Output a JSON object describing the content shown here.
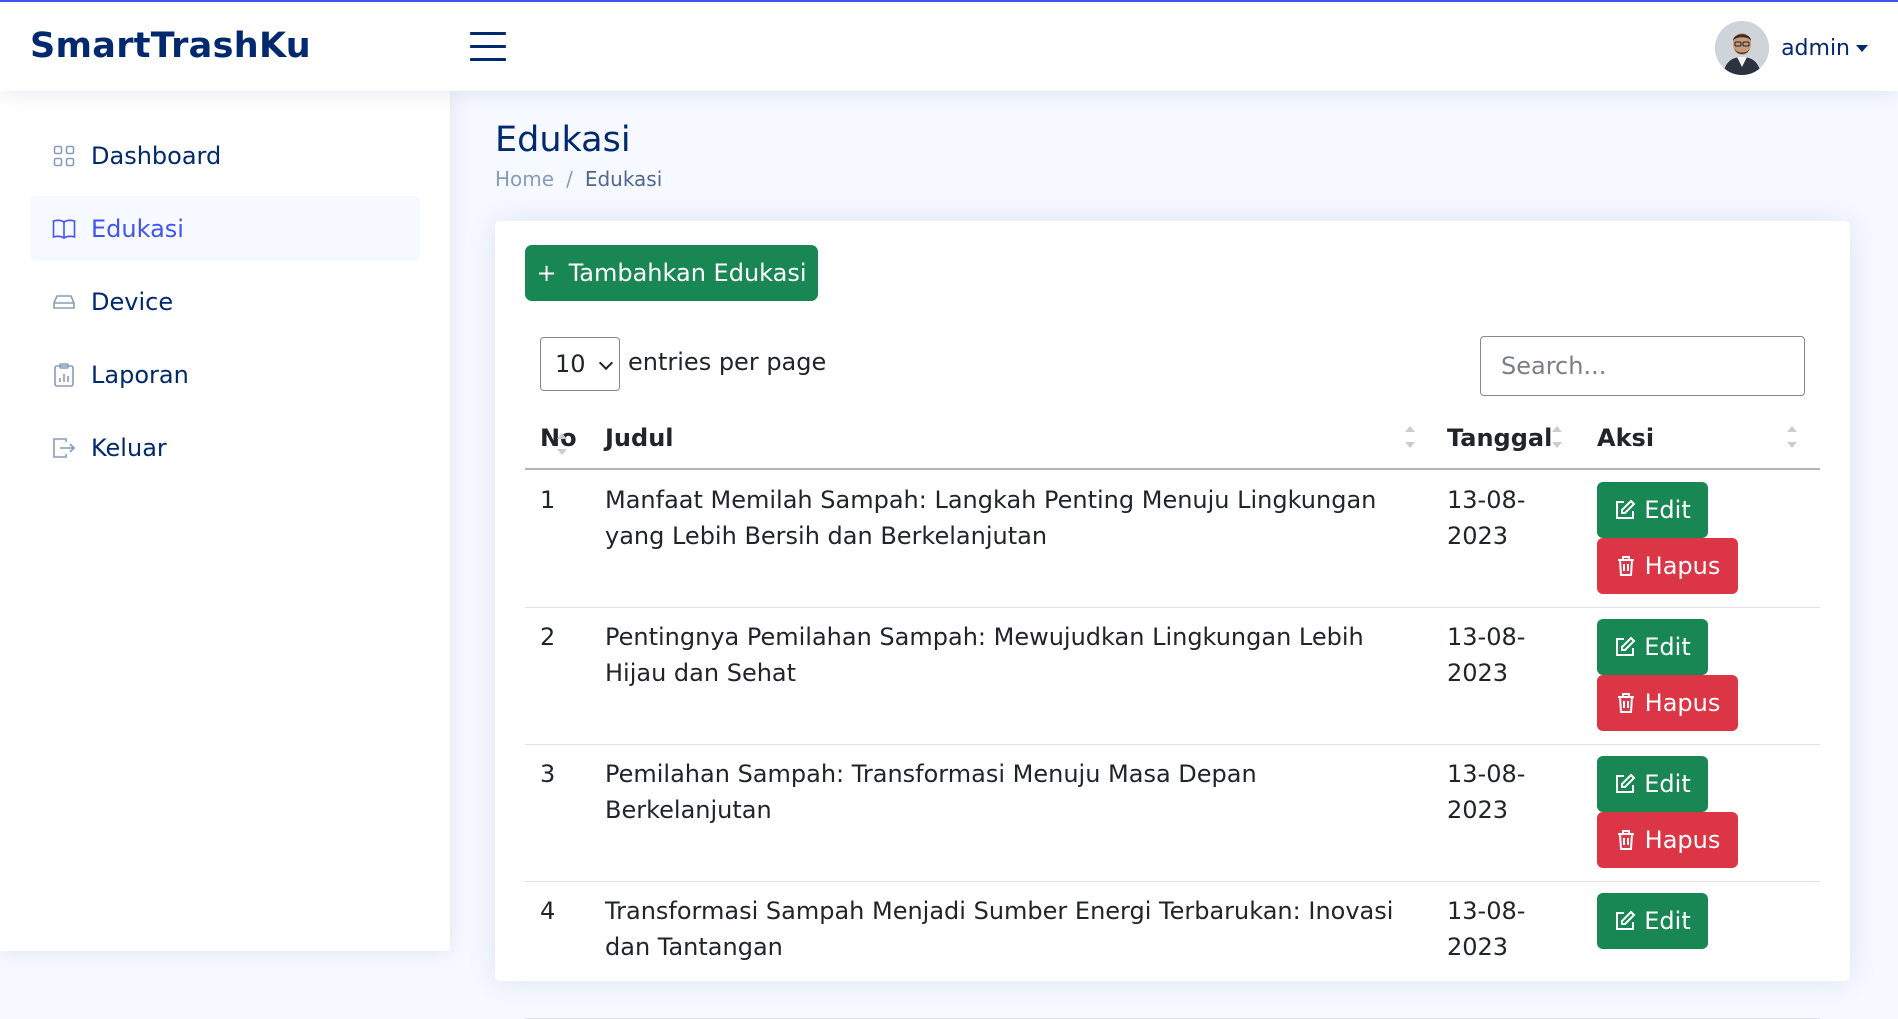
{
  "header": {
    "logo": "SmartTrashKu",
    "user_name": "admin"
  },
  "sidebar": {
    "items": [
      {
        "label": "Dashboard",
        "icon": "grid-icon"
      },
      {
        "label": "Edukasi",
        "icon": "book-icon",
        "active": true
      },
      {
        "label": "Device",
        "icon": "hdd-icon"
      },
      {
        "label": "Laporan",
        "icon": "clipboard-chart-icon"
      },
      {
        "label": "Keluar",
        "icon": "logout-icon"
      }
    ]
  },
  "page": {
    "title": "Edukasi",
    "breadcrumb": {
      "home": "Home",
      "separator": "/",
      "current": "Edukasi"
    }
  },
  "toolbar": {
    "add_label": "Tambahkan Edukasi",
    "add_icon": "+",
    "entries_value": "10",
    "entries_label": "entries per page",
    "search_placeholder": "Search..."
  },
  "table": {
    "headers": {
      "no": "No",
      "judul": "Judul",
      "tanggal": "Tanggal",
      "aksi": "Aksi"
    },
    "edit_label": "Edit",
    "delete_label": "Hapus",
    "rows": [
      {
        "no": "1",
        "judul": "Manfaat Memilah Sampah: Langkah Penting Menuju Lingkungan yang Lebih Bersih dan Berkelanjutan",
        "tanggal": "13-08-2023"
      },
      {
        "no": "2",
        "judul": "Pentingnya Pemilahan Sampah: Mewujudkan Lingkungan Lebih Hijau dan Sehat",
        "tanggal": "13-08-2023"
      },
      {
        "no": "3",
        "judul": "Pemilahan Sampah: Transformasi Menuju Masa Depan Berkelanjutan",
        "tanggal": "13-08-2023"
      },
      {
        "no": "4",
        "judul": "Transformasi Sampah Menjadi Sumber Energi Terbarukan: Inovasi dan Tantangan",
        "tanggal": "13-08-2023"
      }
    ]
  },
  "colors": {
    "primary": "#012970",
    "accent": "#4154f1",
    "success": "#198754",
    "danger": "#dc3545"
  }
}
